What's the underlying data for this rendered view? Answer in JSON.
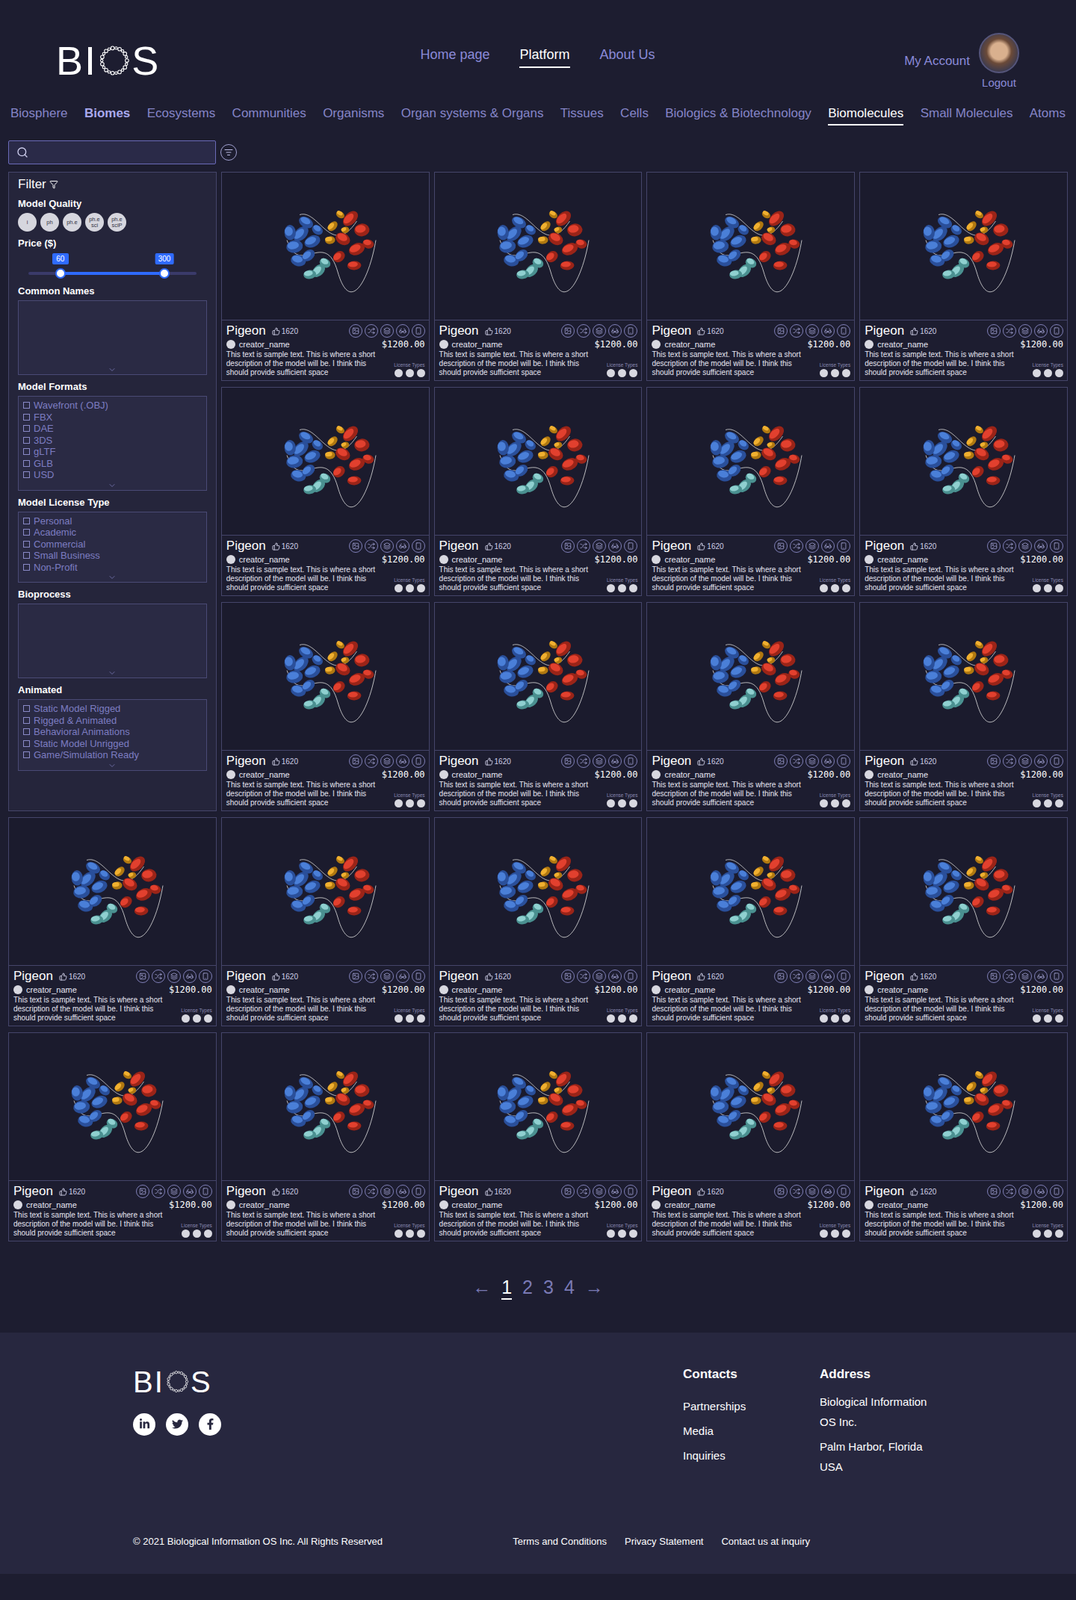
{
  "header": {
    "logo": {
      "before": "BI",
      "after": "S"
    },
    "nav": [
      {
        "label": "Home page",
        "selected": false
      },
      {
        "label": "Platform",
        "selected": true
      },
      {
        "label": "About Us",
        "selected": false
      }
    ],
    "account": "My Account",
    "logout": "Logout"
  },
  "categories": [
    {
      "label": "Biosphere",
      "selected": false,
      "emphasized": false
    },
    {
      "label": "Biomes",
      "selected": false,
      "emphasized": true
    },
    {
      "label": "Ecosystems",
      "selected": false,
      "emphasized": false
    },
    {
      "label": "Communities",
      "selected": false,
      "emphasized": false
    },
    {
      "label": "Organisms",
      "selected": false,
      "emphasized": false
    },
    {
      "label": "Organ systems & Organs",
      "selected": false,
      "emphasized": false
    },
    {
      "label": "Tissues",
      "selected": false,
      "emphasized": false
    },
    {
      "label": "Cells",
      "selected": false,
      "emphasized": false
    },
    {
      "label": "Biologics & Biotechnology",
      "selected": false,
      "emphasized": false
    },
    {
      "label": "Biomolecules",
      "selected": true,
      "emphasized": false
    },
    {
      "label": "Small Molecules",
      "selected": false,
      "emphasized": false
    },
    {
      "label": "Atoms",
      "selected": false,
      "emphasized": false
    }
  ],
  "filter": {
    "title": "Filter",
    "quality": {
      "label": "Model Quality",
      "options": [
        {
          "label": "i",
          "selected": false
        },
        {
          "label": "ph",
          "selected": false
        },
        {
          "label": "ph.e",
          "selected": false
        },
        {
          "label": "ph.e sci",
          "selected": false
        },
        {
          "label": "ph.e sciP",
          "selected": false
        }
      ]
    },
    "price": {
      "label": "Price ($)",
      "low": {
        "value": "60",
        "level": 0.19
      },
      "high": {
        "value": "300",
        "level": 0.81
      }
    },
    "sections": [
      {
        "label": "Common Names",
        "kind": "box",
        "items": []
      },
      {
        "label": "Model Formats",
        "kind": "checklist",
        "items": [
          {
            "label": "Wavefront (.OBJ)",
            "checked": false
          },
          {
            "label": "FBX",
            "checked": false
          },
          {
            "label": "DAE",
            "checked": false
          },
          {
            "label": "3DS",
            "checked": false
          },
          {
            "label": "gLTF",
            "checked": false
          },
          {
            "label": "GLB",
            "checked": false
          },
          {
            "label": "USD",
            "checked": false
          }
        ]
      },
      {
        "label": "Model License Type",
        "kind": "checklist",
        "items": [
          {
            "label": "Personal",
            "checked": false
          },
          {
            "label": "Academic",
            "checked": false
          },
          {
            "label": "Commercial",
            "checked": false
          },
          {
            "label": "Small Business",
            "checked": false
          },
          {
            "label": "Non-Profit",
            "checked": false
          }
        ]
      },
      {
        "label": "Bioprocess",
        "kind": "box",
        "items": []
      },
      {
        "label": "Animated",
        "kind": "checklist",
        "items": [
          {
            "label": "Static Model Rigged",
            "checked": false
          },
          {
            "label": "Rigged & Animated",
            "checked": false
          },
          {
            "label": "Behavioral Animations",
            "checked": false
          },
          {
            "label": "Static Model Unrigged",
            "checked": false
          },
          {
            "label": "Game/Simulation Ready",
            "checked": false
          }
        ]
      }
    ]
  },
  "cards": [
    {
      "title": "Pigeon",
      "likes": "1620",
      "creator": "creator_name",
      "price": "$1200.00",
      "description": "This text is sample text. This is where a short description of the model will be. I think this should provide sufficient space",
      "license_label": "License Types",
      "license_count": 3
    },
    {
      "title": "Pigeon",
      "likes": "1620",
      "creator": "creator_name",
      "price": "$1200.00",
      "description": "This text is sample text. This is where a short description of the model will be. I think this should provide sufficient space",
      "license_label": "License Types",
      "license_count": 3
    },
    {
      "title": "Pigeon",
      "likes": "1620",
      "creator": "creator_name",
      "price": "$1200.00",
      "description": "This text is sample text. This is where a short description of the model will be. I think this should provide sufficient space",
      "license_label": "License Types",
      "license_count": 3
    },
    {
      "title": "Pigeon",
      "likes": "1620",
      "creator": "creator_name",
      "price": "$1200.00",
      "description": "This text is sample text. This is where a short description of the model will be. I think this should provide sufficient space",
      "license_label": "License Types",
      "license_count": 3
    },
    {
      "title": "Pigeon",
      "likes": "1620",
      "creator": "creator_name",
      "price": "$1200.00",
      "description": "This text is sample text. This is where a short description of the model will be. I think this should provide sufficient space",
      "license_label": "License Types",
      "license_count": 3
    },
    {
      "title": "Pigeon",
      "likes": "1620",
      "creator": "creator_name",
      "price": "$1200.00",
      "description": "This text is sample text. This is where a short description of the model will be. I think this should provide sufficient space",
      "license_label": "License Types",
      "license_count": 3
    },
    {
      "title": "Pigeon",
      "likes": "1620",
      "creator": "creator_name",
      "price": "$1200.00",
      "description": "This text is sample text. This is where a short description of the model will be. I think this should provide sufficient space",
      "license_label": "License Types",
      "license_count": 3
    },
    {
      "title": "Pigeon",
      "likes": "1620",
      "creator": "creator_name",
      "price": "$1200.00",
      "description": "This text is sample text. This is where a short description of the model will be. I think this should provide sufficient space",
      "license_label": "License Types",
      "license_count": 3
    },
    {
      "title": "Pigeon",
      "likes": "1620",
      "creator": "creator_name",
      "price": "$1200.00",
      "description": "This text is sample text. This is where a short description of the model will be. I think this should provide sufficient space",
      "license_label": "License Types",
      "license_count": 3
    },
    {
      "title": "Pigeon",
      "likes": "1620",
      "creator": "creator_name",
      "price": "$1200.00",
      "description": "This text is sample text. This is where a short description of the model will be. I think this should provide sufficient space",
      "license_label": "License Types",
      "license_count": 3
    },
    {
      "title": "Pigeon",
      "likes": "1620",
      "creator": "creator_name",
      "price": "$1200.00",
      "description": "This text is sample text. This is where a short description of the model will be. I think this should provide sufficient space",
      "license_label": "License Types",
      "license_count": 3
    },
    {
      "title": "Pigeon",
      "likes": "1620",
      "creator": "creator_name",
      "price": "$1200.00",
      "description": "This text is sample text. This is where a short description of the model will be. I think this should provide sufficient space",
      "license_label": "License Types",
      "license_count": 3
    },
    {
      "title": "Pigeon",
      "likes": "1620",
      "creator": "creator_name",
      "price": "$1200.00",
      "description": "This text is sample text. This is where a short description of the model will be. I think this should provide sufficient space",
      "license_label": "License Types",
      "license_count": 3
    },
    {
      "title": "Pigeon",
      "likes": "1620",
      "creator": "creator_name",
      "price": "$1200.00",
      "description": "This text is sample text. This is where a short description of the model will be. I think this should provide sufficient space",
      "license_label": "License Types",
      "license_count": 3
    },
    {
      "title": "Pigeon",
      "likes": "1620",
      "creator": "creator_name",
      "price": "$1200.00",
      "description": "This text is sample text. This is where a short description of the model will be. I think this should provide sufficient space",
      "license_label": "License Types",
      "license_count": 3
    },
    {
      "title": "Pigeon",
      "likes": "1620",
      "creator": "creator_name",
      "price": "$1200.00",
      "description": "This text is sample text. This is where a short description of the model will be. I think this should provide sufficient space",
      "license_label": "License Types",
      "license_count": 3
    },
    {
      "title": "Pigeon",
      "likes": "1620",
      "creator": "creator_name",
      "price": "$1200.00",
      "description": "This text is sample text. This is where a short description of the model will be. I think this should provide sufficient space",
      "license_label": "License Types",
      "license_count": 3
    },
    {
      "title": "Pigeon",
      "likes": "1620",
      "creator": "creator_name",
      "price": "$1200.00",
      "description": "This text is sample text. This is where a short description of the model will be. I think this should provide sufficient space",
      "license_label": "License Types",
      "license_count": 3
    },
    {
      "title": "Pigeon",
      "likes": "1620",
      "creator": "creator_name",
      "price": "$1200.00",
      "description": "This text is sample text. This is where a short description of the model will be. I think this should provide sufficient space",
      "license_label": "License Types",
      "license_count": 3
    },
    {
      "title": "Pigeon",
      "likes": "1620",
      "creator": "creator_name",
      "price": "$1200.00",
      "description": "This text is sample text. This is where a short description of the model will be. I think this should provide sufficient space",
      "license_label": "License Types",
      "license_count": 3
    },
    {
      "title": "Pigeon",
      "likes": "1620",
      "creator": "creator_name",
      "price": "$1200.00",
      "description": "This text is sample text. This is where a short description of the model will be. I think this should provide sufficient space",
      "license_label": "License Types",
      "license_count": 3
    },
    {
      "title": "Pigeon",
      "likes": "1620",
      "creator": "creator_name",
      "price": "$1200.00",
      "description": "This text is sample text. This is where a short description of the model will be. I think this should provide sufficient space",
      "license_label": "License Types",
      "license_count": 3
    }
  ],
  "pagination": {
    "prev": "←",
    "pages": [
      {
        "label": "1",
        "selected": true
      },
      {
        "label": "2",
        "selected": false
      },
      {
        "label": "3",
        "selected": false
      },
      {
        "label": "4",
        "selected": false
      }
    ],
    "next": "→"
  },
  "footer": {
    "logo": {
      "before": "BI",
      "after": "S"
    },
    "contacts": {
      "title": "Contacts",
      "links": [
        "Partnerships",
        "Media",
        "Inquiries"
      ]
    },
    "address": {
      "title": "Address",
      "lines": [
        "Biological Information",
        "OS Inc.",
        "Palm Harbor, Florida",
        "USA"
      ]
    },
    "copyright": "© 2021 Biological Information OS Inc. All Rights Reserved",
    "links": [
      "Terms and Conditions",
      "Privacy Statement",
      "Contact us at inquiry"
    ]
  }
}
